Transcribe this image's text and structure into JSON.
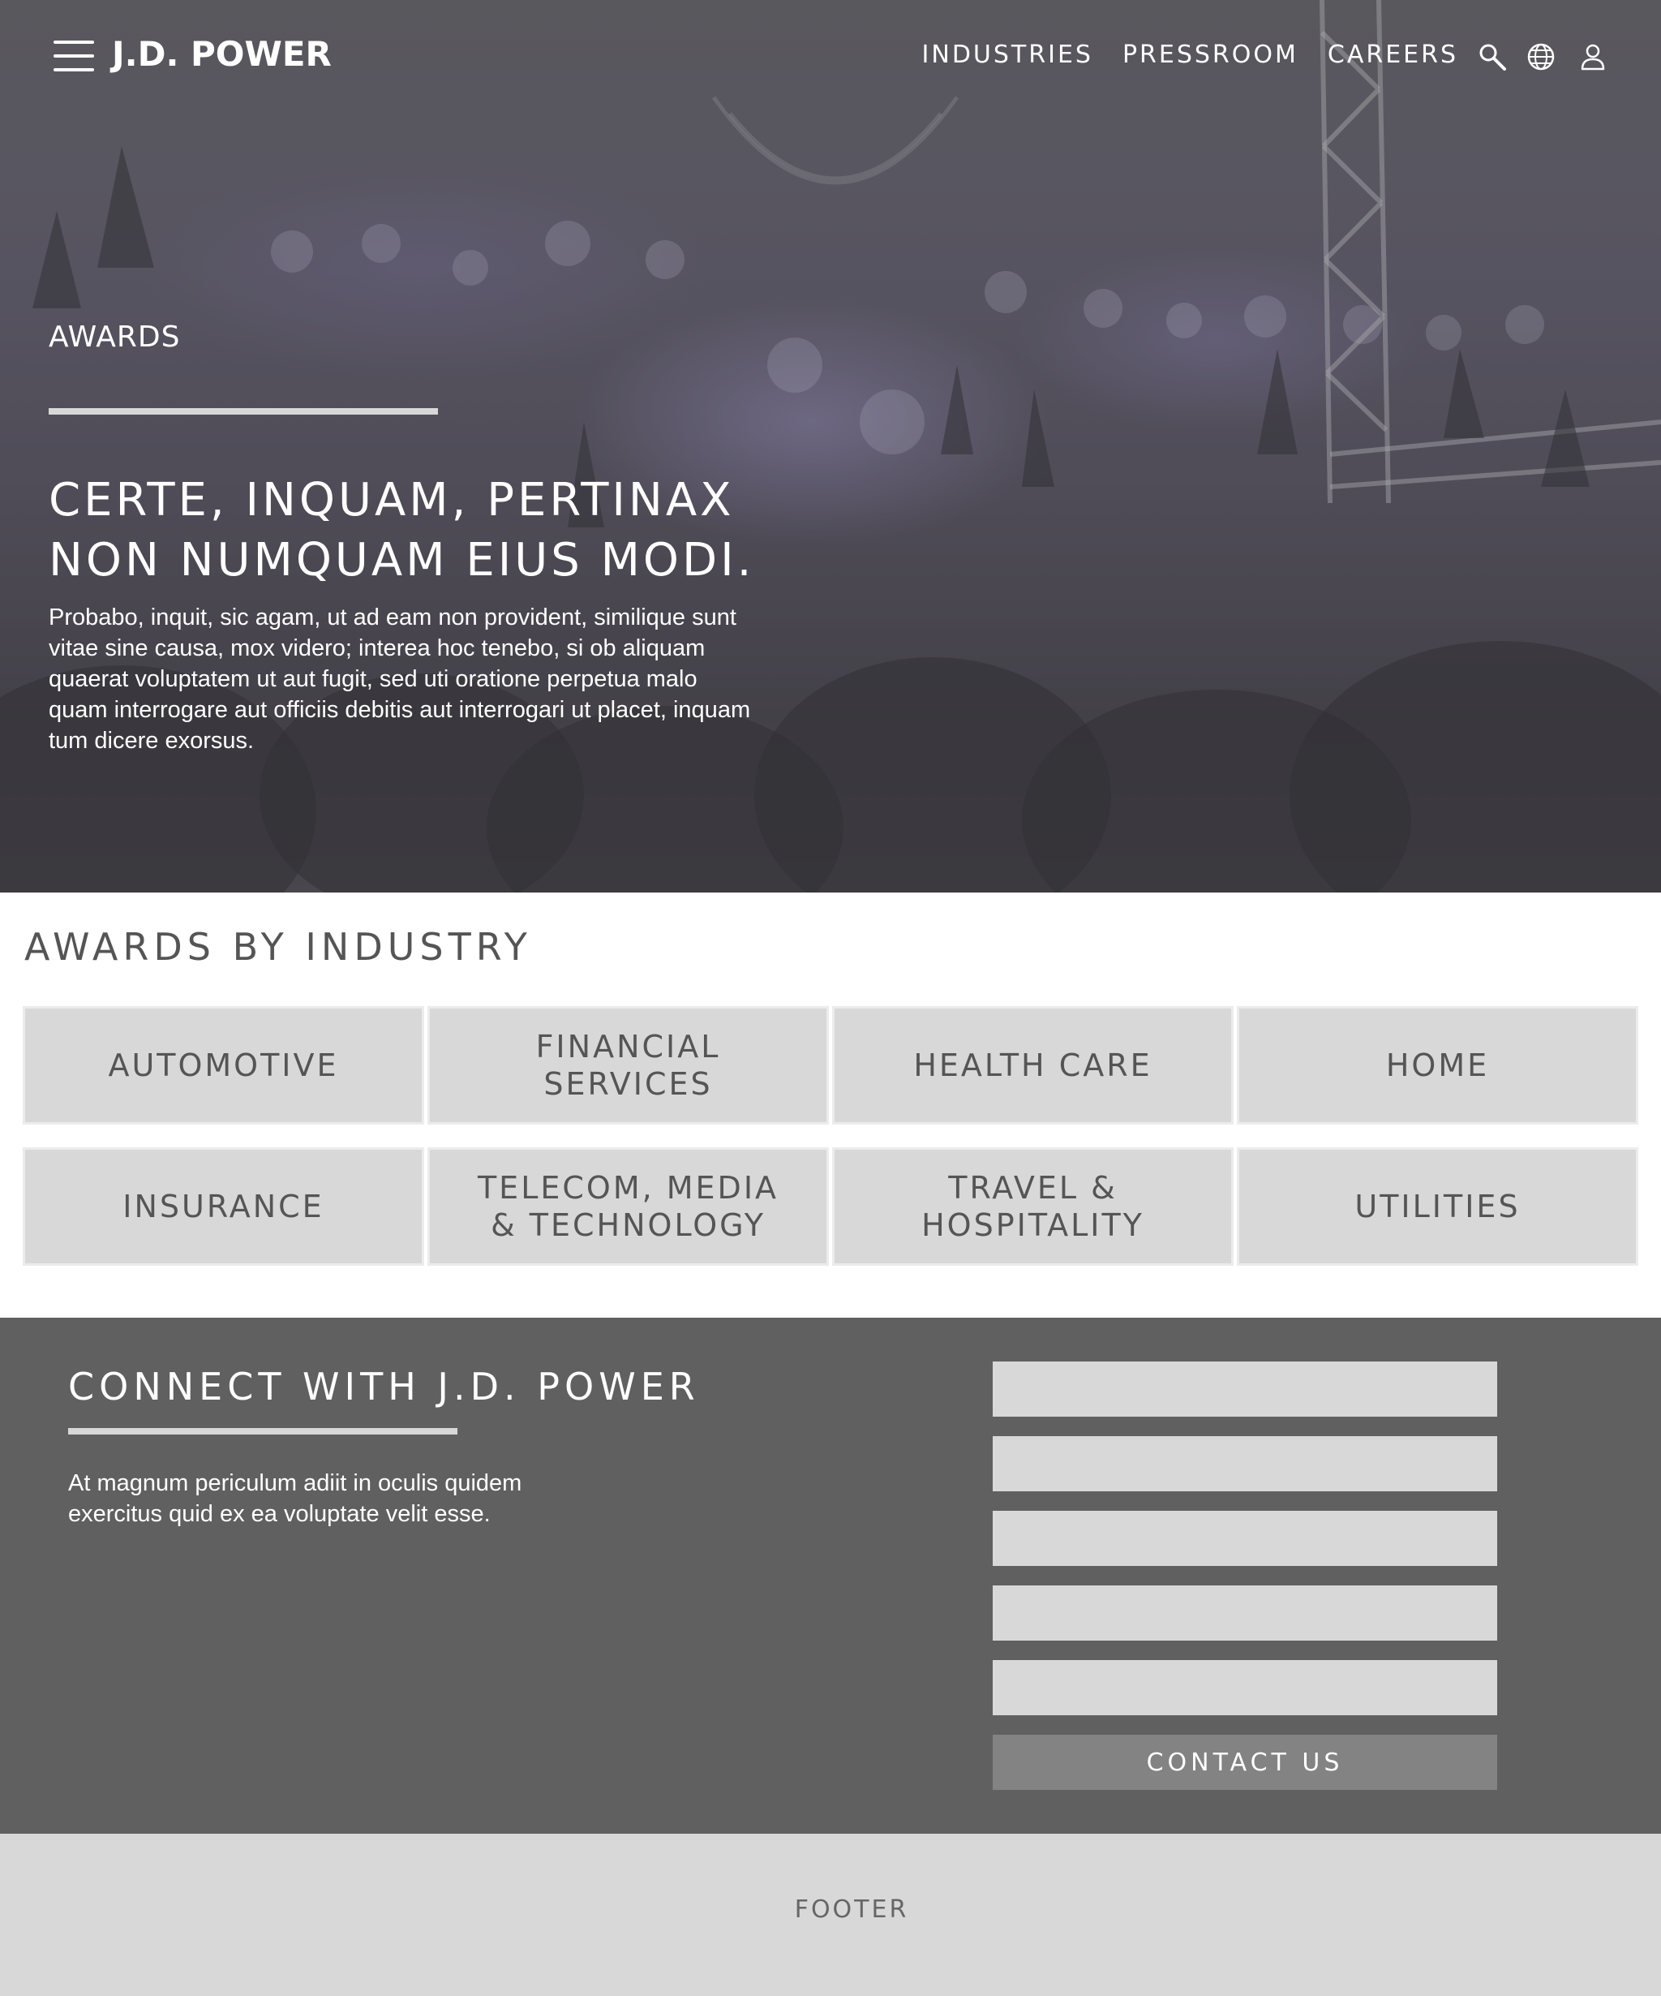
{
  "header": {
    "logo": "J.D. POWER",
    "nav": [
      "INDUSTRIES",
      "PRESSROOM",
      "CAREERS"
    ],
    "icons": [
      "search-icon",
      "globe-icon",
      "user-icon"
    ]
  },
  "hero": {
    "eyebrow": "AWARDS",
    "title": "CERTE, INQUAM, PERTINAX NON NUMQUAM EIUS MODI.",
    "body": "Probabo, inquit, sic agam, ut ad eam non provident, similique sunt vitae sine causa, mox videro; interea hoc tenebo, si ob aliquam quaerat voluptatem ut aut fugit, sed uti oratione perpetua malo quam interrogare aut officiis debitis aut interrogari ut placet, inquam tum dicere exorsus."
  },
  "awards": {
    "heading": "AWARDS BY INDUSTRY",
    "industries": [
      "AUTOMOTIVE",
      "FINANCIAL SERVICES",
      "HEALTH CARE",
      "HOME",
      "INSURANCE",
      "TELECOM, MEDIA & TECHNOLOGY",
      "TRAVEL & HOSPITALITY",
      "UTILITIES"
    ]
  },
  "connect": {
    "title": "CONNECT WITH J.D. POWER",
    "body": "At magnum periculum adiit in oculis quidem exercitus quid ex ea voluptate velit esse.",
    "button": "CONTACT US"
  },
  "footer": {
    "label": "FOOTER"
  },
  "colors": {
    "hero_overlay": "#5f5e62",
    "tile_bg": "#d8d8d8",
    "connect_bg": "#606060",
    "button_bg": "#848384",
    "footer_bg": "#d8d8d8"
  }
}
